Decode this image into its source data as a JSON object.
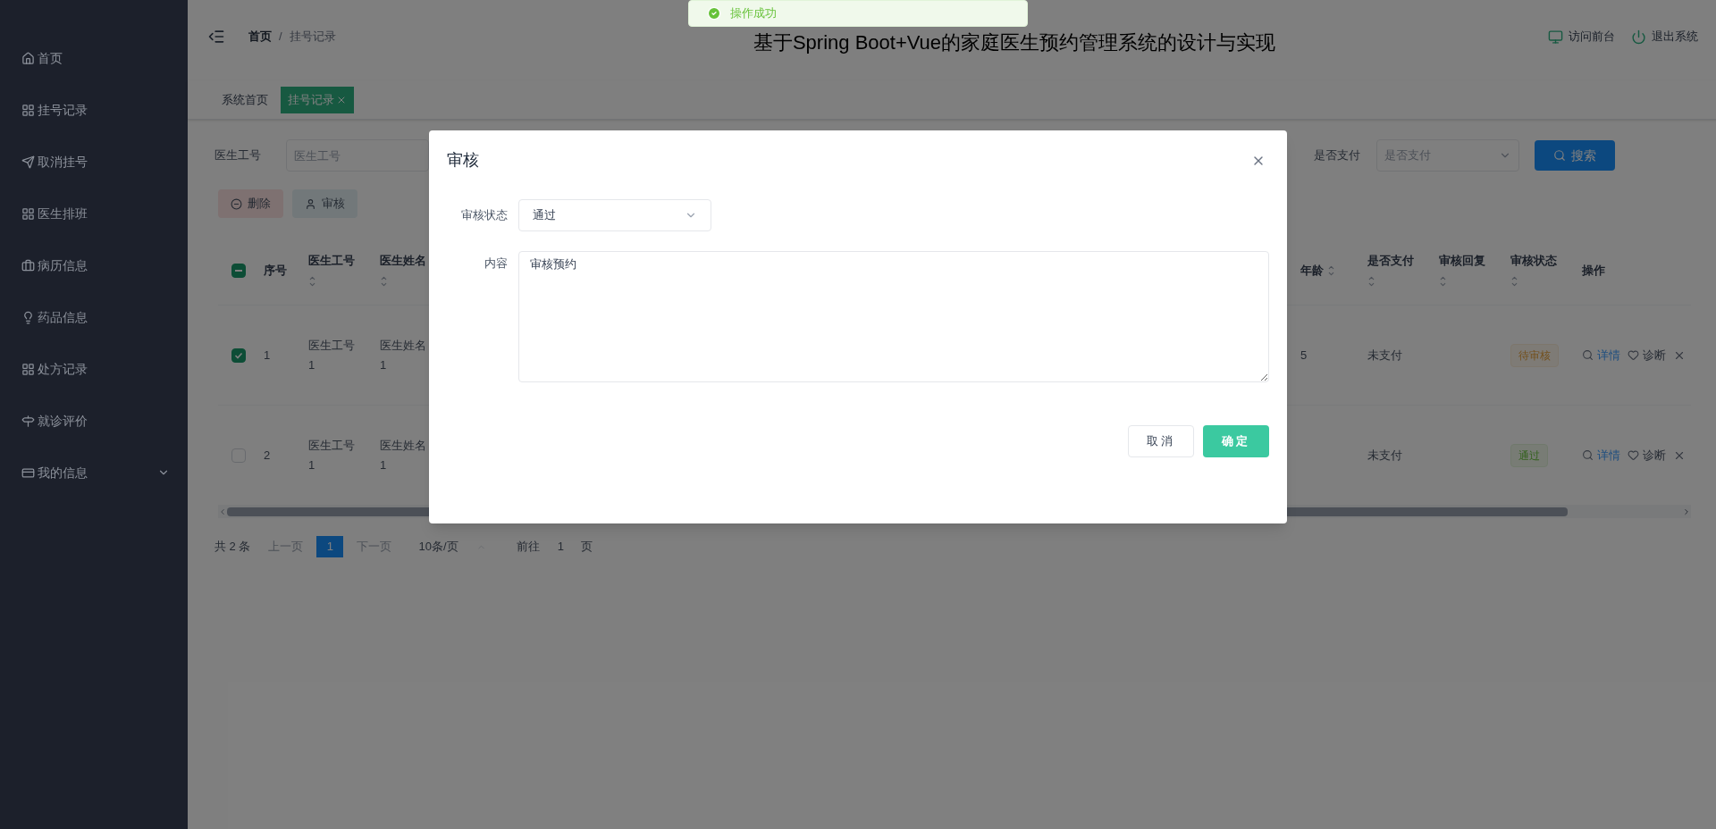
{
  "sidebar": {
    "items": [
      {
        "label": "首页",
        "kind": "link"
      },
      {
        "label": "挂号记录",
        "kind": "link"
      },
      {
        "label": "取消挂号",
        "kind": "link"
      },
      {
        "label": "医生排班",
        "kind": "link"
      },
      {
        "label": "病历信息",
        "kind": "link"
      },
      {
        "label": "药品信息",
        "kind": "link"
      },
      {
        "label": "处方记录",
        "kind": "link"
      },
      {
        "label": "就诊评价",
        "kind": "link"
      },
      {
        "label": "我的信息",
        "kind": "submenu"
      }
    ]
  },
  "header": {
    "breadcrumb": [
      "首页",
      "挂号记录"
    ],
    "breadcrumb_separator": "/",
    "title": "基于Spring Boot+Vue的家庭医生预约管理系统的设计与实现",
    "actions": [
      "访问前台",
      "退出系统"
    ]
  },
  "toast": {
    "message": "操作成功",
    "kind": "success"
  },
  "tabs": [
    {
      "label": "系统首页",
      "selected": false
    },
    {
      "label": "挂号记录",
      "selected": true
    }
  ],
  "filters": [
    {
      "label": "医生工号",
      "placeholder": "医生工号",
      "kind": "input"
    },
    {
      "label": "是否支付",
      "placeholder": "是否支付",
      "kind": "select"
    }
  ],
  "search_button": "搜索",
  "toolbar": [
    {
      "label": "删除",
      "kind": "danger"
    },
    {
      "label": "审核",
      "kind": "info"
    }
  ],
  "table": {
    "select_all": {
      "indeterminate": true
    },
    "columns": [
      {
        "label": "序号",
        "sortable": false
      },
      {
        "label": "医生工号",
        "sortable": true
      },
      {
        "label": "医生姓名",
        "sortable": true
      },
      {
        "label": "年龄",
        "sortable": true
      },
      {
        "label": "是否支付",
        "sortable": true
      },
      {
        "label": "审核回复",
        "sortable": true
      },
      {
        "label": "审核状态",
        "sortable": true
      },
      {
        "label": "操作",
        "sortable": false
      }
    ],
    "rows": [
      {
        "selected": true,
        "index": "1",
        "doctor_id": "医生工号1",
        "doctor_name": "医生姓名1",
        "age": "5",
        "paid": "未支付",
        "status": {
          "label": "待审核",
          "kind": "warning"
        },
        "actions": [
          "详情",
          "诊断"
        ]
      },
      {
        "selected": false,
        "index": "2",
        "doctor_id": "医生工号1",
        "doctor_name": "医生姓名1",
        "paid": "未支付",
        "status": {
          "label": "通过",
          "kind": "success"
        },
        "actions": [
          "详情",
          "诊断"
        ]
      }
    ]
  },
  "pagination": {
    "total": "共 2 条",
    "prev": "上一页",
    "pages": [
      {
        "label": "1",
        "selected": true
      }
    ],
    "next": "下一页",
    "page_size": "10条/页",
    "goto_label": "前往",
    "goto_value": "1",
    "goto_suffix": "页"
  },
  "dialog": {
    "title": "审核",
    "fields": [
      {
        "label": "审核状态",
        "kind": "select",
        "value": "通过"
      },
      {
        "label": "内容",
        "kind": "textarea",
        "value": "审核预约"
      }
    ],
    "buttons": [
      {
        "label": "取消",
        "kind": "default"
      },
      {
        "label": "确定",
        "kind": "primary"
      }
    ]
  }
}
